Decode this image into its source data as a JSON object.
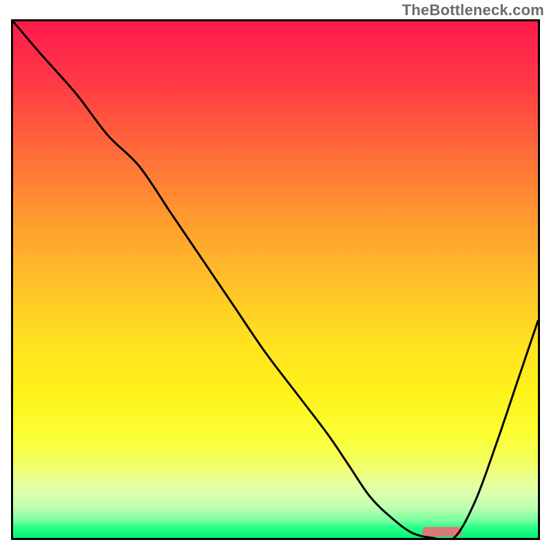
{
  "watermark": "TheBottleneck.com",
  "colors": {
    "gradient_top": "#ff1a4b",
    "gradient_mid": "#ffe11f",
    "gradient_bottom": "#01f577",
    "curve": "#000000",
    "marker": "#d97a78",
    "border": "#000000"
  },
  "chart_data": {
    "type": "line",
    "title": "",
    "xlabel": "",
    "ylabel": "",
    "xlim": [
      0,
      100
    ],
    "ylim": [
      0,
      100
    ],
    "x": [
      0,
      5,
      12,
      18,
      24,
      30,
      36,
      42,
      48,
      54,
      60,
      64,
      68,
      72,
      76,
      80,
      84,
      88,
      92,
      96,
      100
    ],
    "values": [
      100,
      94,
      86,
      78,
      72,
      63,
      54,
      45,
      36,
      28,
      20,
      14,
      8,
      4,
      1,
      0,
      0,
      7,
      18,
      30,
      42
    ],
    "marker": {
      "x_start": 78,
      "x_end": 85.5,
      "y": 0.5
    },
    "grid": false,
    "legend": false
  }
}
